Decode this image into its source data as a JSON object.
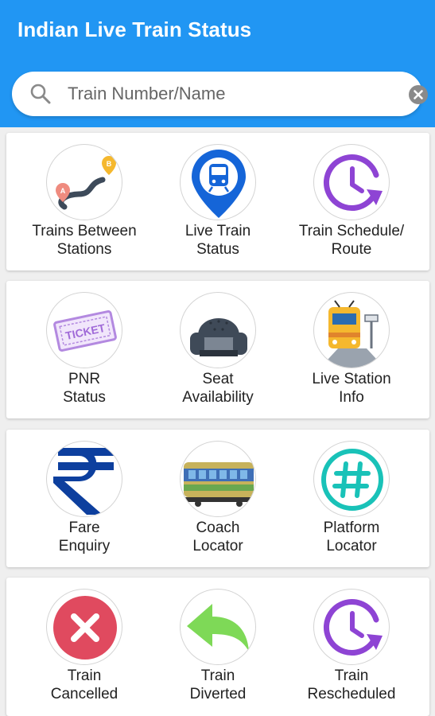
{
  "app": {
    "title": "Indian Live Train Status"
  },
  "search": {
    "placeholder": "Train Number/Name",
    "value": ""
  },
  "cards": [
    {
      "items": [
        {
          "line1": "Trains Between",
          "line2": "Stations",
          "icon": "route-icon"
        },
        {
          "line1": "Live Train",
          "line2": "Status",
          "icon": "train-location-icon"
        },
        {
          "line1": "Train Schedule/",
          "line2": "Route",
          "icon": "clock-icon"
        }
      ]
    },
    {
      "items": [
        {
          "line1": "PNR",
          "line2": "Status",
          "icon": "ticket-icon"
        },
        {
          "line1": "Seat",
          "line2": "Availability",
          "icon": "armchair-icon"
        },
        {
          "line1": "Live Station",
          "line2": "Info",
          "icon": "train-station-icon"
        }
      ]
    },
    {
      "items": [
        {
          "line1": "Fare",
          "line2": "Enquiry",
          "icon": "rupee-icon"
        },
        {
          "line1": "Coach",
          "line2": "Locator",
          "icon": "coach-icon"
        },
        {
          "line1": "Platform",
          "line2": "Locator",
          "icon": "hashtag-icon"
        }
      ]
    },
    {
      "items": [
        {
          "line1": "Train",
          "line2": "Cancelled",
          "icon": "cancel-icon"
        },
        {
          "line1": "Train",
          "line2": "Diverted",
          "icon": "diverted-arrow-icon"
        },
        {
          "line1": "Train",
          "line2": "Rescheduled",
          "icon": "clock-icon"
        }
      ]
    }
  ],
  "colors": {
    "appbar": "#2196f3",
    "accent_purple": "#8e44d4",
    "cancel_red": "#e04a5f",
    "divert_green": "#7ed957"
  }
}
